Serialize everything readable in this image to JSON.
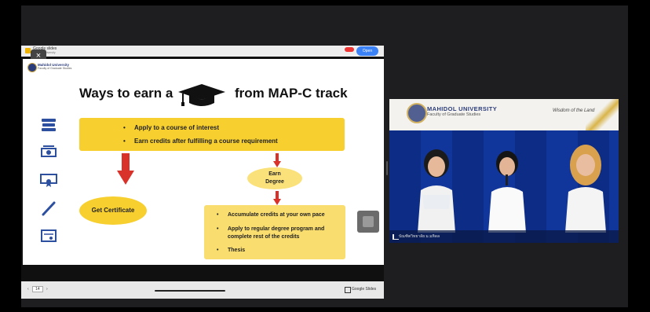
{
  "slide_window": {
    "file_name": "Google slides",
    "file_sub": "Mahidol University",
    "open_button": "Open",
    "close_label": "×",
    "bottom": {
      "prev": "‹",
      "page": "14",
      "next": "›",
      "app_label": "Google Slides"
    }
  },
  "slide": {
    "logo_title": "Mahidol University",
    "logo_sub": "Faculty of Graduate Studies",
    "title_left": "Ways to earn a",
    "title_right": "from MAP-C track",
    "top_box": [
      "Apply to a course of interest",
      "Earn credits after fulfilling a course requirement"
    ],
    "earn_degree_line1": "Earn",
    "earn_degree_line2": "Degree",
    "certificate": "Get Certificate",
    "bottom_box": [
      "Accumulate credits at your own pace",
      "Apply to regular degree program and",
      "complete rest of the credits",
      "Thesis"
    ],
    "colors": {
      "accent_yellow": "#f7cf2e",
      "arrow_red": "#d9322a",
      "icon_blue": "#2d4fa0"
    }
  },
  "video": {
    "header_line1": "MAHIDOL UNIVERSITY",
    "header_line2": "Faculty of Graduate Studies",
    "header_right": "Wisdom of the Land",
    "caption": "บัณฑิตวิทยาลัย ม.มหิดล"
  }
}
